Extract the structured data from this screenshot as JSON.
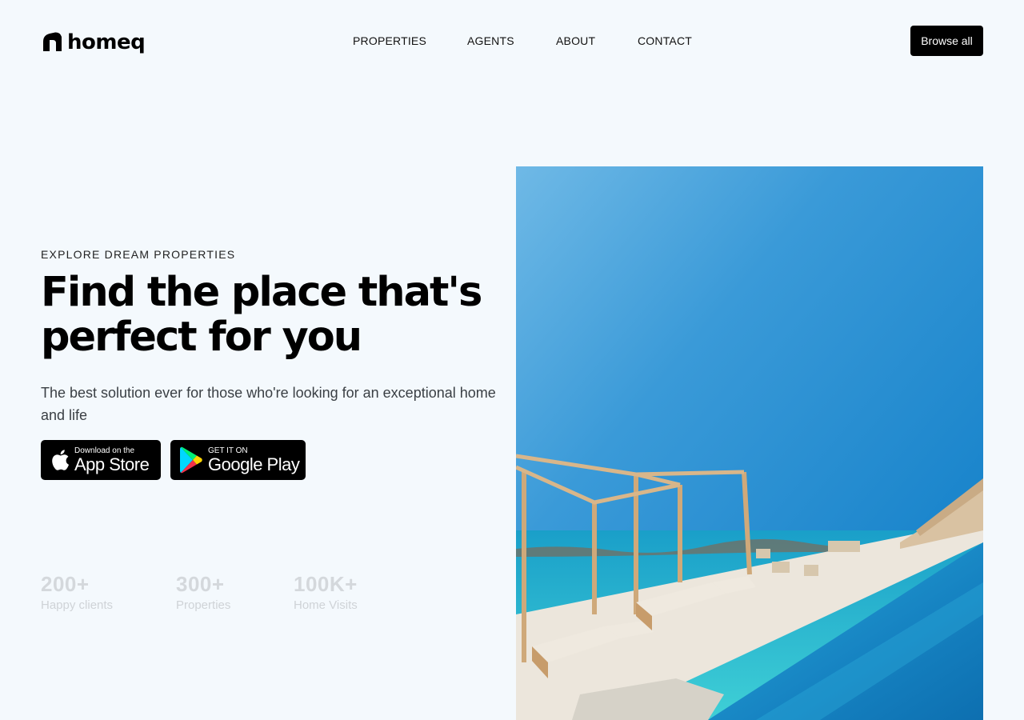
{
  "brand": {
    "name": "homeq"
  },
  "nav": {
    "items": [
      "PROPERTIES",
      "AGENTS",
      "ABOUT",
      "CONTACT"
    ],
    "cta_label": "Browse all"
  },
  "hero": {
    "eyebrow": "EXPLORE DREAM PROPERTIES",
    "title": "Find the place that's perfect for you",
    "subtitle": "The best solution ever for those who're looking for an exceptional home and life",
    "app_store": {
      "small": "Download on the",
      "big": "App Store"
    },
    "google_play": {
      "small": "GET IT ON",
      "big": "Google Play"
    },
    "stats": [
      {
        "value": "200+",
        "label": "Happy clients"
      },
      {
        "value": "300+",
        "label": "Properties"
      },
      {
        "value": "100K+",
        "label": "Home Visits"
      }
    ]
  },
  "colors": {
    "background": "#f4f9fd",
    "cta": "#000000",
    "stat_muted": "#d4d8dc"
  },
  "icons": {
    "logo": "house-roof-mark",
    "app_store": "apple-icon",
    "google_play": "play-triangle-icon"
  }
}
